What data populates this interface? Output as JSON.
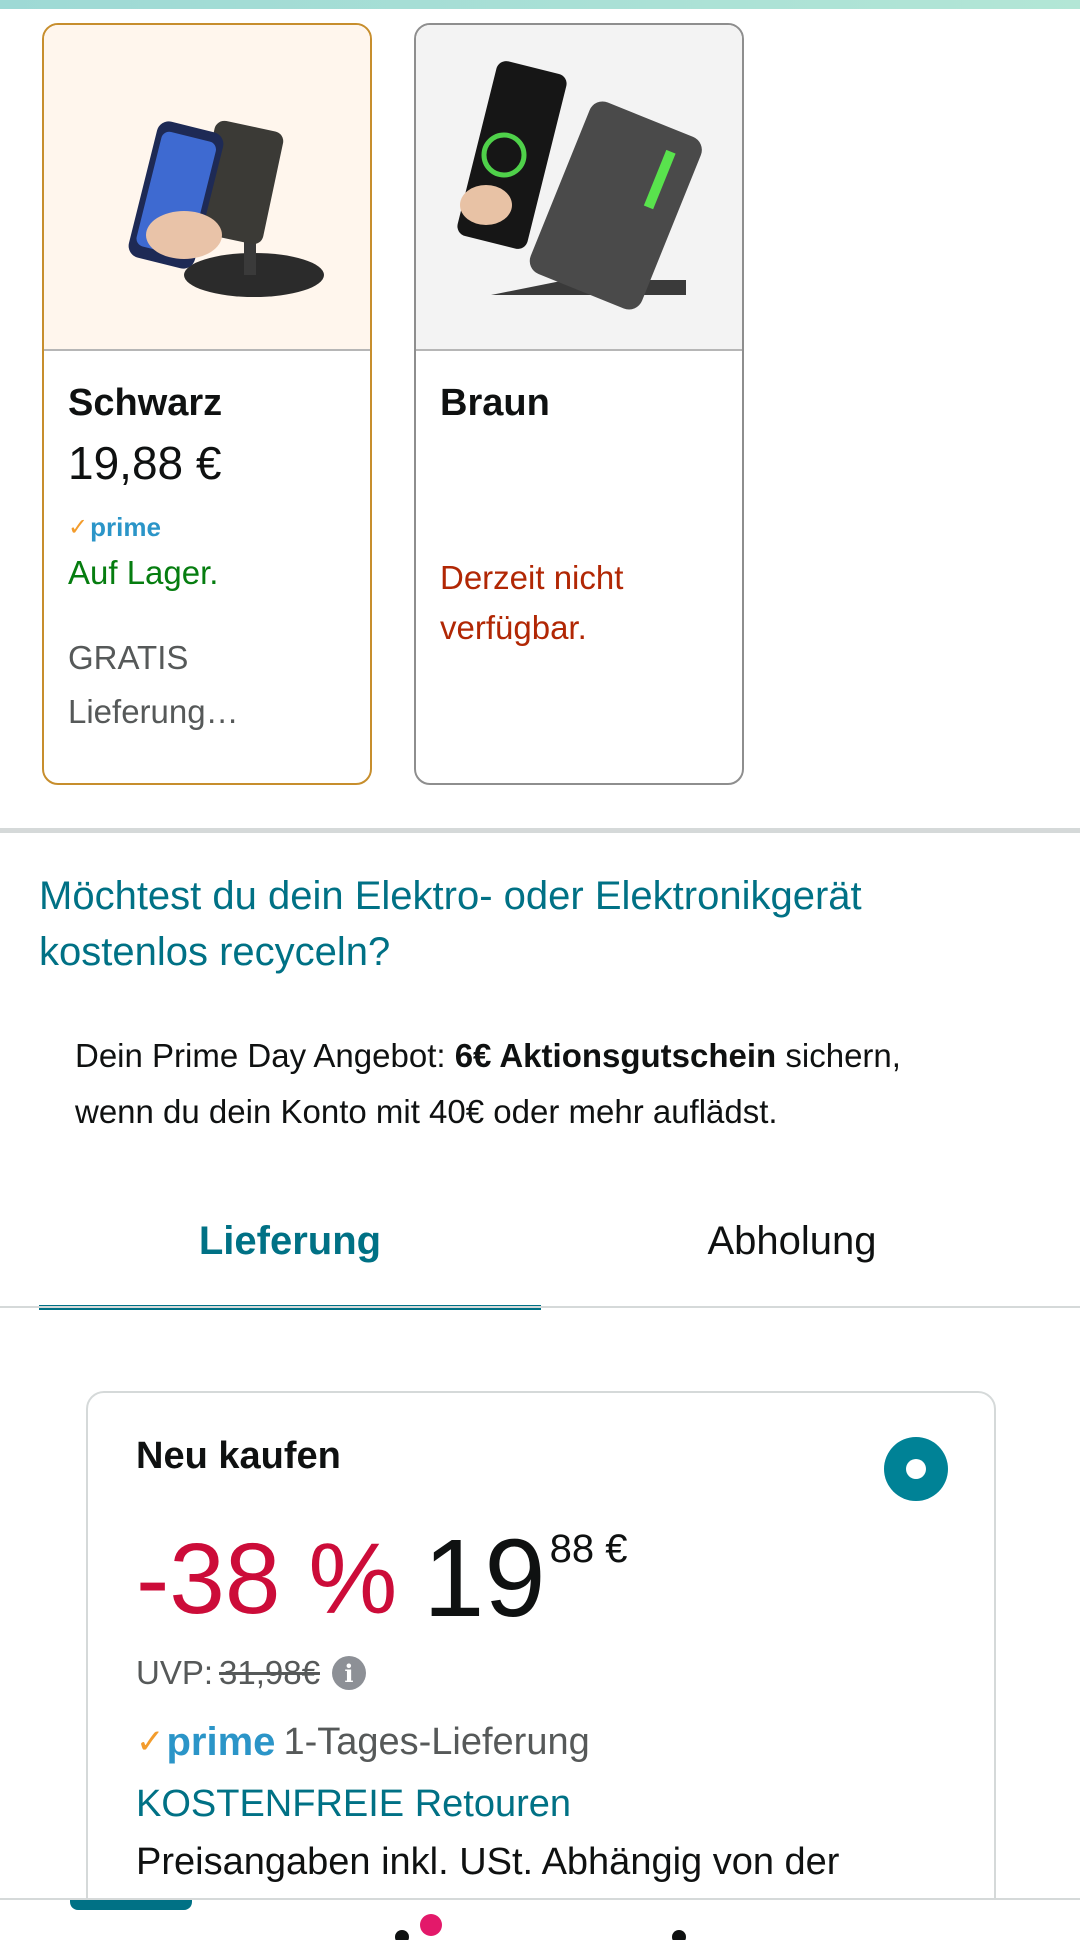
{
  "variants": [
    {
      "name": "Schwarz",
      "price": "19,88 €",
      "prime_check": "✓",
      "prime_label": "prime",
      "stock": "Auf Lager.",
      "delivery_line1": "GRATIS",
      "delivery_line2": "Lieferung…"
    },
    {
      "name": "Braun",
      "availability_line1": "Derzeit nicht",
      "availability_line2": "verfügbar."
    }
  ],
  "recycle": {
    "line1": "Möchtest du dein Elektro- oder Elektronikgerät",
    "line2": "kostenlos recyceln?"
  },
  "promo": {
    "prefix": "Dein Prime Day Angebot: ",
    "bold": "6€ Aktionsgutschein",
    "suffix": " sichern,",
    "line2": "wenn du dein Konto mit 40€ oder mehr auflädst."
  },
  "tabs": {
    "delivery": "Lieferung",
    "pickup": "Abholung"
  },
  "buy_box": {
    "title": "Neu kaufen",
    "discount": "-38 %",
    "price_whole": "19",
    "price_fraction": "88 €",
    "uvp_label": "UVP:",
    "uvp_value": "31,98€",
    "info_glyph": "i",
    "prime_check": "✓",
    "prime_label": "prime",
    "delivery": "1-Tages-Lieferung",
    "returns": "KOSTENFREIE Retouren",
    "tax_note": "Preisangaben inkl. USt. Abhängig von der"
  },
  "colors": {
    "link": "#007185",
    "discount": "#cc0c39",
    "in_stock": "#067d10",
    "unavailable": "#b12704",
    "selected_border": "#c78e2d",
    "prime_blue": "#2b95c8",
    "prime_orange": "#f39c2c"
  }
}
